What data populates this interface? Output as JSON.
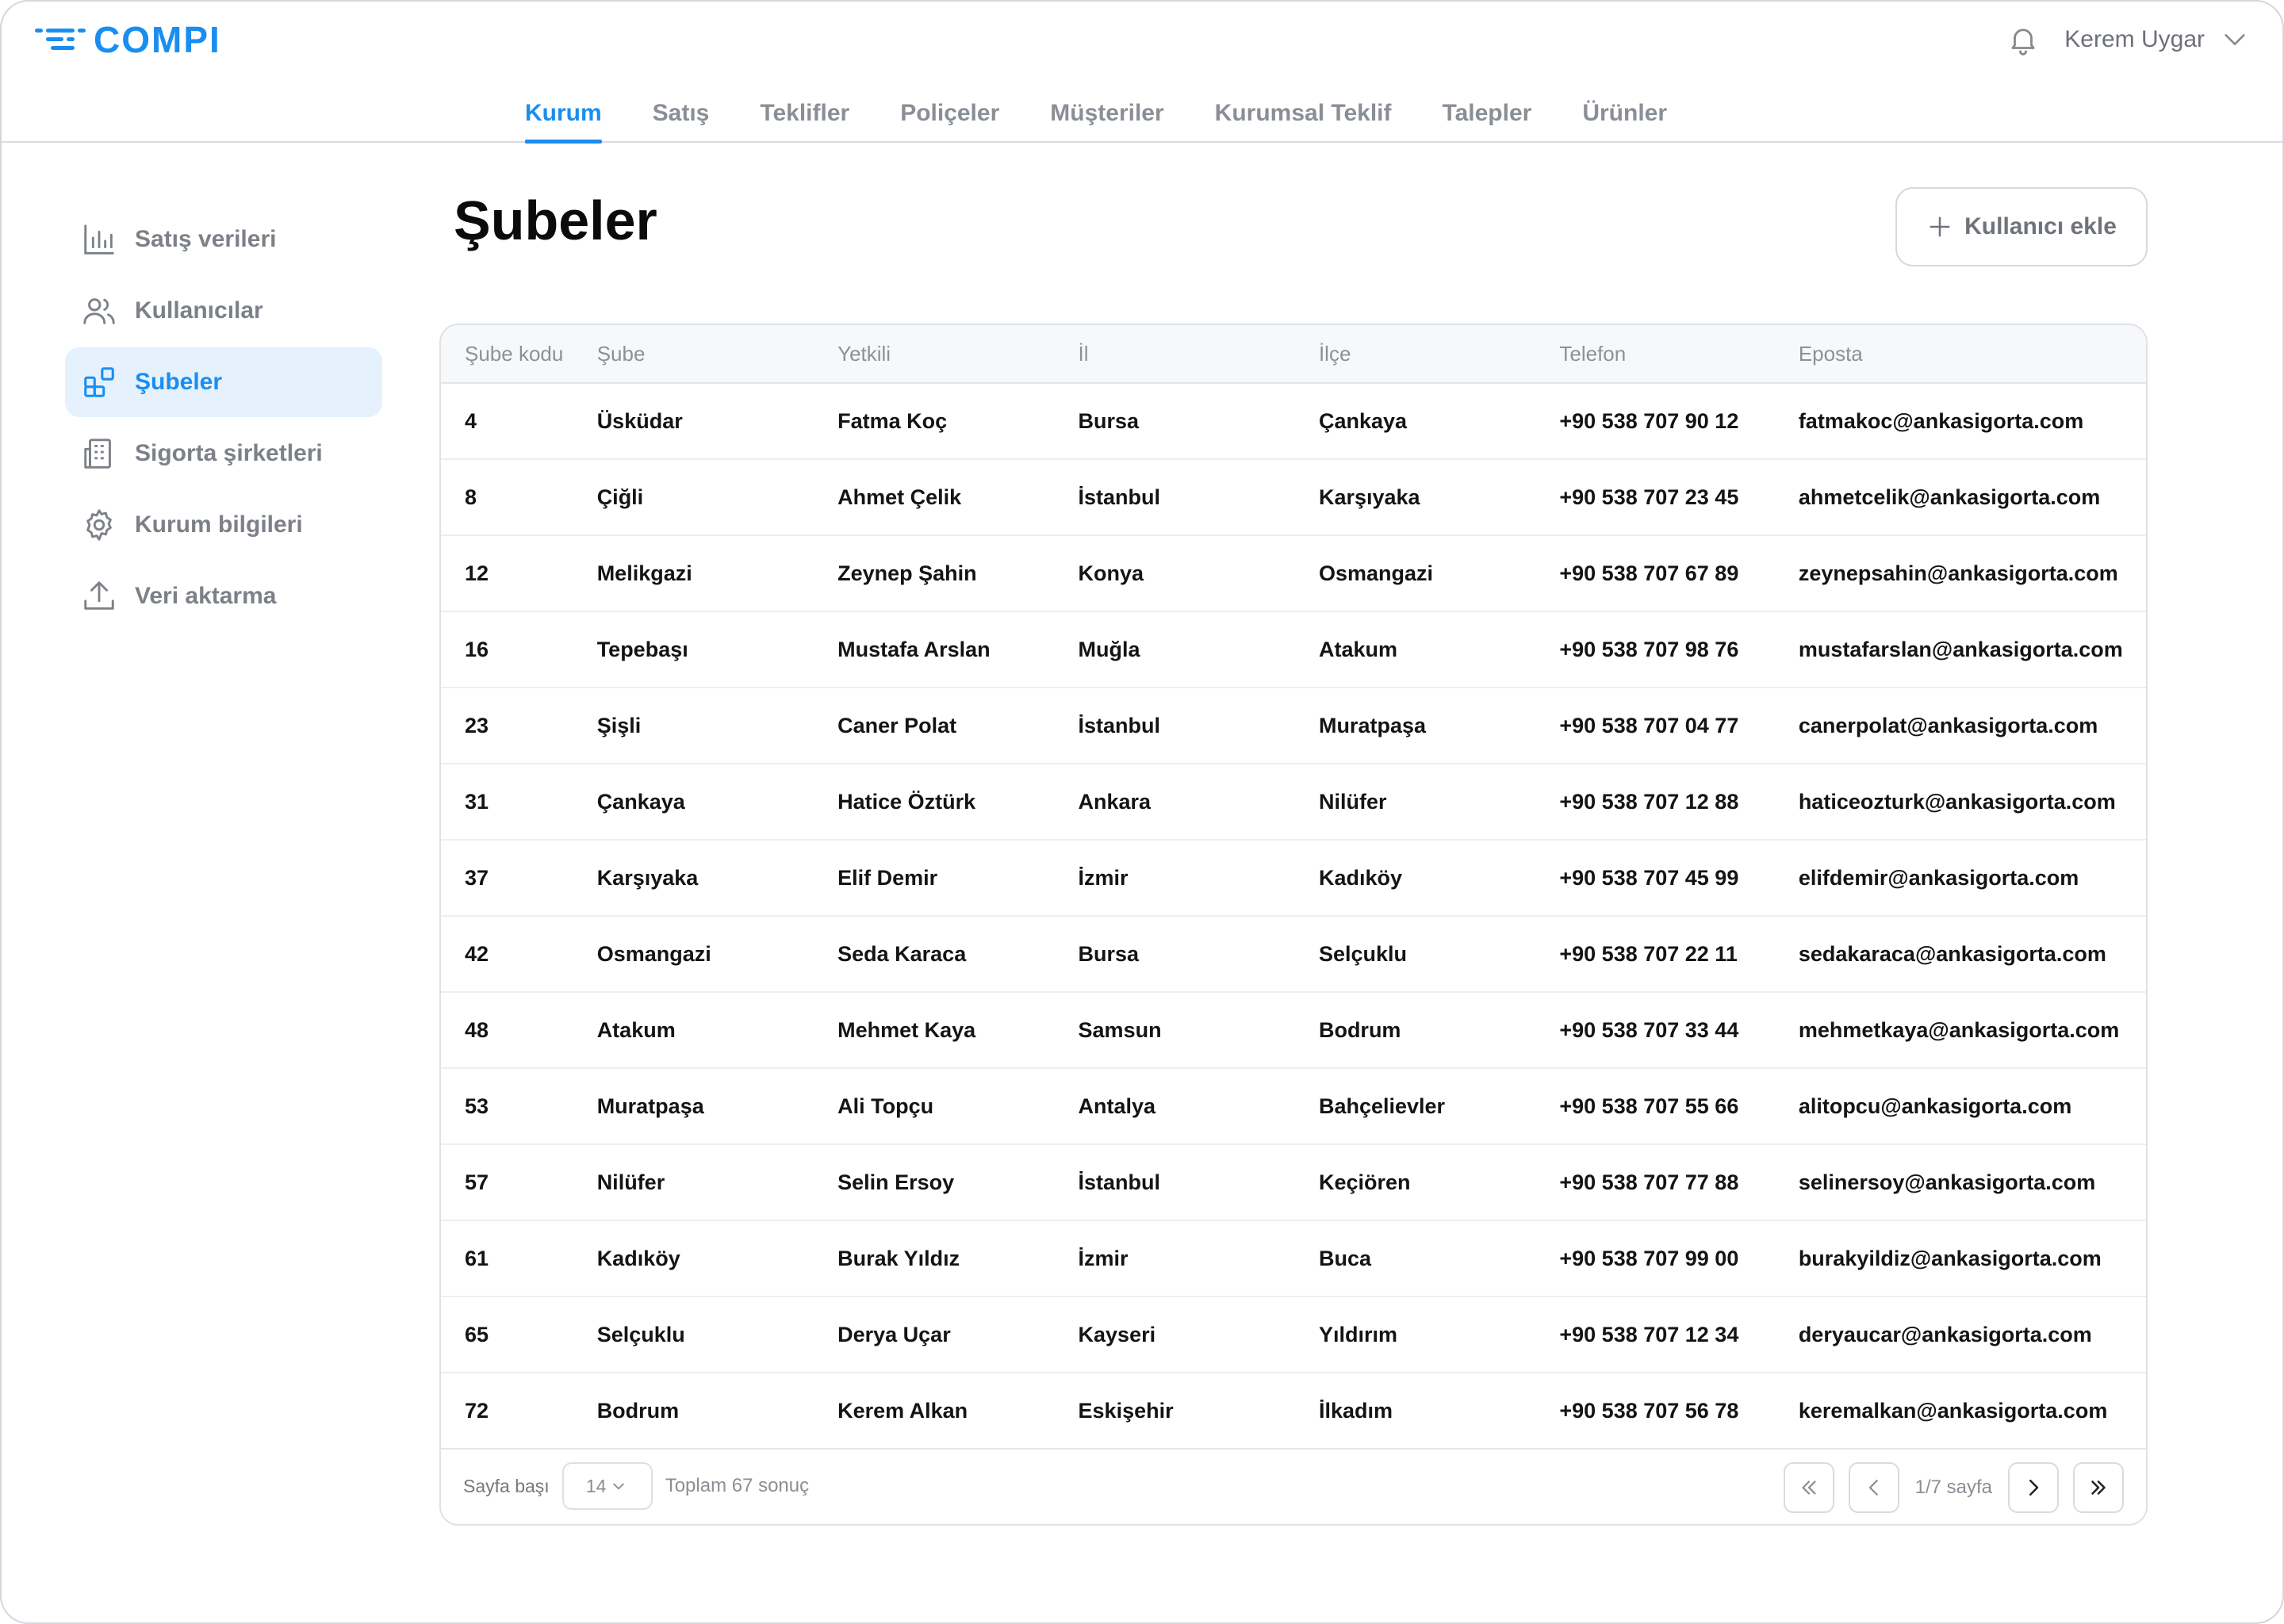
{
  "app": {
    "brand": "COMPI"
  },
  "user": {
    "name": "Kerem Uygar"
  },
  "nav": {
    "tabs": [
      {
        "label": "Kurum",
        "active": true
      },
      {
        "label": "Satış"
      },
      {
        "label": "Teklifler"
      },
      {
        "label": "Poliçeler"
      },
      {
        "label": "Müşteriler"
      },
      {
        "label": "Kurumsal Teklif"
      },
      {
        "label": "Talepler"
      },
      {
        "label": "Ürünler"
      }
    ]
  },
  "sidebar": {
    "items": [
      {
        "label": "Satış verileri",
        "icon": "bar-chart-icon"
      },
      {
        "label": "Kullanıcılar",
        "icon": "users-icon"
      },
      {
        "label": "Şubeler",
        "icon": "branches-icon",
        "active": true
      },
      {
        "label": "Sigorta şirketleri",
        "icon": "building-icon"
      },
      {
        "label": "Kurum bilgileri",
        "icon": "gear-icon"
      },
      {
        "label": "Veri aktarma",
        "icon": "upload-icon"
      }
    ]
  },
  "page": {
    "title": "Şubeler",
    "add_button_label": "Kullanıcı ekle"
  },
  "table": {
    "columns": [
      "Şube kodu",
      "Şube",
      "Yetkili",
      "İl",
      "İlçe",
      "Telefon",
      "Eposta"
    ],
    "rows": [
      [
        "4",
        "Üsküdar",
        "Fatma Koç",
        "Bursa",
        "Çankaya",
        "+90 538 707 90 12",
        "fatmakoc@ankasigorta.com"
      ],
      [
        "8",
        "Çiğli",
        "Ahmet Çelik",
        "İstanbul",
        "Karşıyaka",
        "+90 538 707 23 45",
        "ahmetcelik@ankasigorta.com"
      ],
      [
        "12",
        "Melikgazi",
        "Zeynep Şahin",
        "Konya",
        "Osmangazi",
        "+90 538 707 67 89",
        "zeynepsahin@ankasigorta.com"
      ],
      [
        "16",
        "Tepebaşı",
        "Mustafa Arslan",
        "Muğla",
        "Atakum",
        "+90 538 707 98 76",
        "mustafarslan@ankasigorta.com"
      ],
      [
        "23",
        "Şişli",
        "Caner Polat",
        "İstanbul",
        "Muratpaşa",
        "+90 538 707 04 77",
        "canerpolat@ankasigorta.com"
      ],
      [
        "31",
        "Çankaya",
        "Hatice Öztürk",
        "Ankara",
        "Nilüfer",
        "+90 538 707 12 88",
        "haticeozturk@ankasigorta.com"
      ],
      [
        "37",
        "Karşıyaka",
        "Elif Demir",
        "İzmir",
        "Kadıköy",
        "+90 538 707 45 99",
        "elifdemir@ankasigorta.com"
      ],
      [
        "42",
        "Osmangazi",
        "Seda Karaca",
        "Bursa",
        "Selçuklu",
        "+90 538 707 22 11",
        "sedakaraca@ankasigorta.com"
      ],
      [
        "48",
        "Atakum",
        "Mehmet Kaya",
        "Samsun",
        "Bodrum",
        "+90 538 707 33 44",
        "mehmetkaya@ankasigorta.com"
      ],
      [
        "53",
        "Muratpaşa",
        "Ali Topçu",
        "Antalya",
        "Bahçelievler",
        "+90 538 707 55 66",
        "alitopcu@ankasigorta.com"
      ],
      [
        "57",
        "Nilüfer",
        "Selin Ersoy",
        "İstanbul",
        "Keçiören",
        "+90 538 707 77 88",
        "selinersoy@ankasigorta.com"
      ],
      [
        "61",
        "Kadıköy",
        "Burak Yıldız",
        "İzmir",
        "Buca",
        "+90 538 707 99 00",
        "burakyildiz@ankasigorta.com"
      ],
      [
        "65",
        "Selçuklu",
        "Derya Uçar",
        "Kayseri",
        "Yıldırım",
        "+90 538 707 12 34",
        "deryaucar@ankasigorta.com"
      ],
      [
        "72",
        "Bodrum",
        "Kerem Alkan",
        "Eskişehir",
        "İlkadım",
        "+90 538 707 56 78",
        "keremalkan@ankasigorta.com"
      ]
    ]
  },
  "pagination": {
    "per_page_label": "Sayfa başı",
    "per_page_value": "14",
    "total_label": "Toplam 67 sonuç",
    "page_info": "1/7 sayfa"
  },
  "colors": {
    "accent": "#1a8ef0",
    "active_bg": "#e5f2fd",
    "muted": "#8a8f96"
  }
}
